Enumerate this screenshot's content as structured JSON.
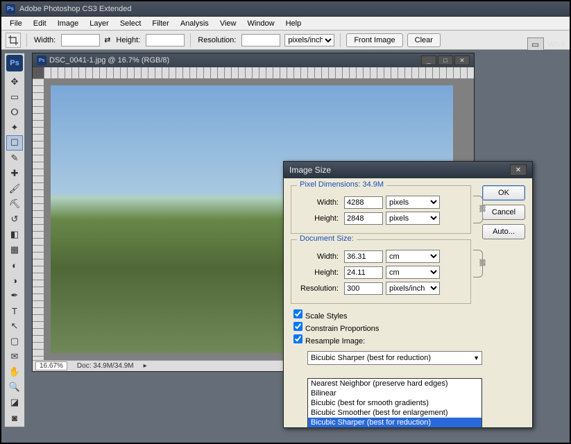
{
  "app": {
    "title": "Adobe Photoshop CS3 Extended",
    "ps_icon": "Ps"
  },
  "menu": [
    "File",
    "Edit",
    "Image",
    "Layer",
    "Select",
    "Filter",
    "Analysis",
    "View",
    "Window",
    "Help"
  ],
  "options": {
    "width_label": "Width:",
    "height_label": "Height:",
    "resolution_label": "Resolution:",
    "unit": "pixels/inch",
    "front_image": "Front Image",
    "clear": "Clear"
  },
  "document": {
    "title": "DSC_0041-1.jpg @ 16.7% (RGB/8)",
    "zoom": "16.67%",
    "docsize": "Doc: 34.9M/34.9M"
  },
  "dialog": {
    "title": "Image Size",
    "pixel_dimensions_label": "Pixel Dimensions:",
    "pixel_dimensions_value": "34.9M",
    "pixel_width": "4288",
    "pixel_height": "2848",
    "pixel_unit": "pixels",
    "doc_size_label": "Document Size:",
    "doc_width": "36.31",
    "doc_height": "24.11",
    "doc_unit": "cm",
    "resolution": "300",
    "resolution_unit": "pixels/inch",
    "width_label": "Width:",
    "height_label": "Height:",
    "resolution_label": "Resolution:",
    "scale_styles": "Scale Styles",
    "constrain": "Constrain Proportions",
    "resample": "Resample Image:",
    "resample_selected": "Bicubic Sharper (best for reduction)",
    "resample_options": [
      "Nearest Neighbor (preserve hard edges)",
      "Bilinear",
      "Bicubic (best for smooth gradients)",
      "Bicubic Smoother (best for enlargement)",
      "Bicubic Sharper (best for reduction)"
    ],
    "ok": "OK",
    "cancel": "Cancel",
    "auto": "Auto..."
  },
  "right_label": "Work"
}
